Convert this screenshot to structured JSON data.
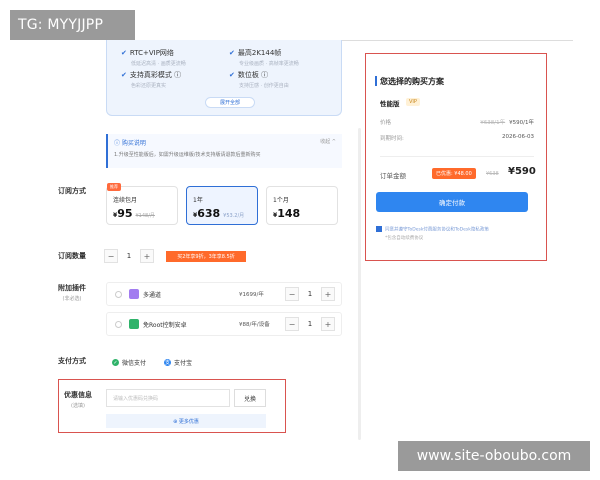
{
  "watermarks": {
    "top": "TG: MYYJJPP",
    "bottom": "www.site-oboubo.com"
  },
  "features": {
    "items": [
      {
        "title": "RTC+VIP网络",
        "sub": "低延迟高清 · 画质更流畅"
      },
      {
        "title": "最高2K144帧",
        "sub": "专业级画质 · 高帧率更流畅"
      },
      {
        "title": "支持真彩模式 ⓘ",
        "sub": "色彩还原更真实"
      },
      {
        "title": "数位板 ⓘ",
        "sub": "支持压感 · 创作更自由"
      }
    ],
    "expand_label": "展开全部"
  },
  "note": {
    "title": "购买说明",
    "text": "1.升级至性能版后，如需升级运维版/技术支持版请退款后重新购买",
    "collapse": "收起"
  },
  "labels": {
    "subscription": "订阅方式",
    "quantity": "订阅数量",
    "addons": "附加插件",
    "addons_sub": "(非必选)",
    "payment": "支付方式",
    "coupon": "优惠信息",
    "coupon_sub": "(选填)"
  },
  "plans": [
    {
      "tag": "推荐",
      "name": "连续包月",
      "currency": "¥",
      "price": "95",
      "old": "¥148/月",
      "per": ""
    },
    {
      "tag": "",
      "name": "1年",
      "currency": "¥",
      "price": "638",
      "old": "",
      "per": "¥53.2/月"
    },
    {
      "tag": "",
      "name": "1个月",
      "currency": "¥",
      "price": "148",
      "old": "",
      "per": ""
    }
  ],
  "quantity": {
    "minus": "−",
    "value": "1",
    "plus": "+",
    "discount": "买2年享9折，3年享8.5折"
  },
  "addons": [
    {
      "name": "多通道",
      "price": "¥1699/年",
      "qty": "1",
      "color": "#a27cf0"
    },
    {
      "name": "免Root控制安卓",
      "price": "¥88/年/设备",
      "qty": "1",
      "color": "#2fb36a"
    }
  ],
  "payment": {
    "wechat": "微信支付",
    "alipay": "支付宝",
    "wechat_color": "#2fb36a",
    "alipay_color": "#2f86f0"
  },
  "coupon": {
    "placeholder": "请输入优惠码兑换码",
    "redeem": "兑换",
    "more": "⊕ 更多优惠"
  },
  "summary": {
    "title": "您选择的购买方案",
    "edition": "性能版",
    "vip": "VIP",
    "price_label": "价格",
    "price_old": "¥638/1年",
    "price_new": "¥590/1年",
    "expire_label": "到期时间:",
    "expire_value": "2026-06-03",
    "total_label": "订单金额",
    "saved": "已优惠: ¥48.00",
    "total_old": "¥638",
    "total": "¥590",
    "pay_button": "确定付款",
    "agreement": "同意并遵守ToDesk付费服务协议和ToDesk隐私政策",
    "auto_note": "*包含自动续费协议"
  }
}
